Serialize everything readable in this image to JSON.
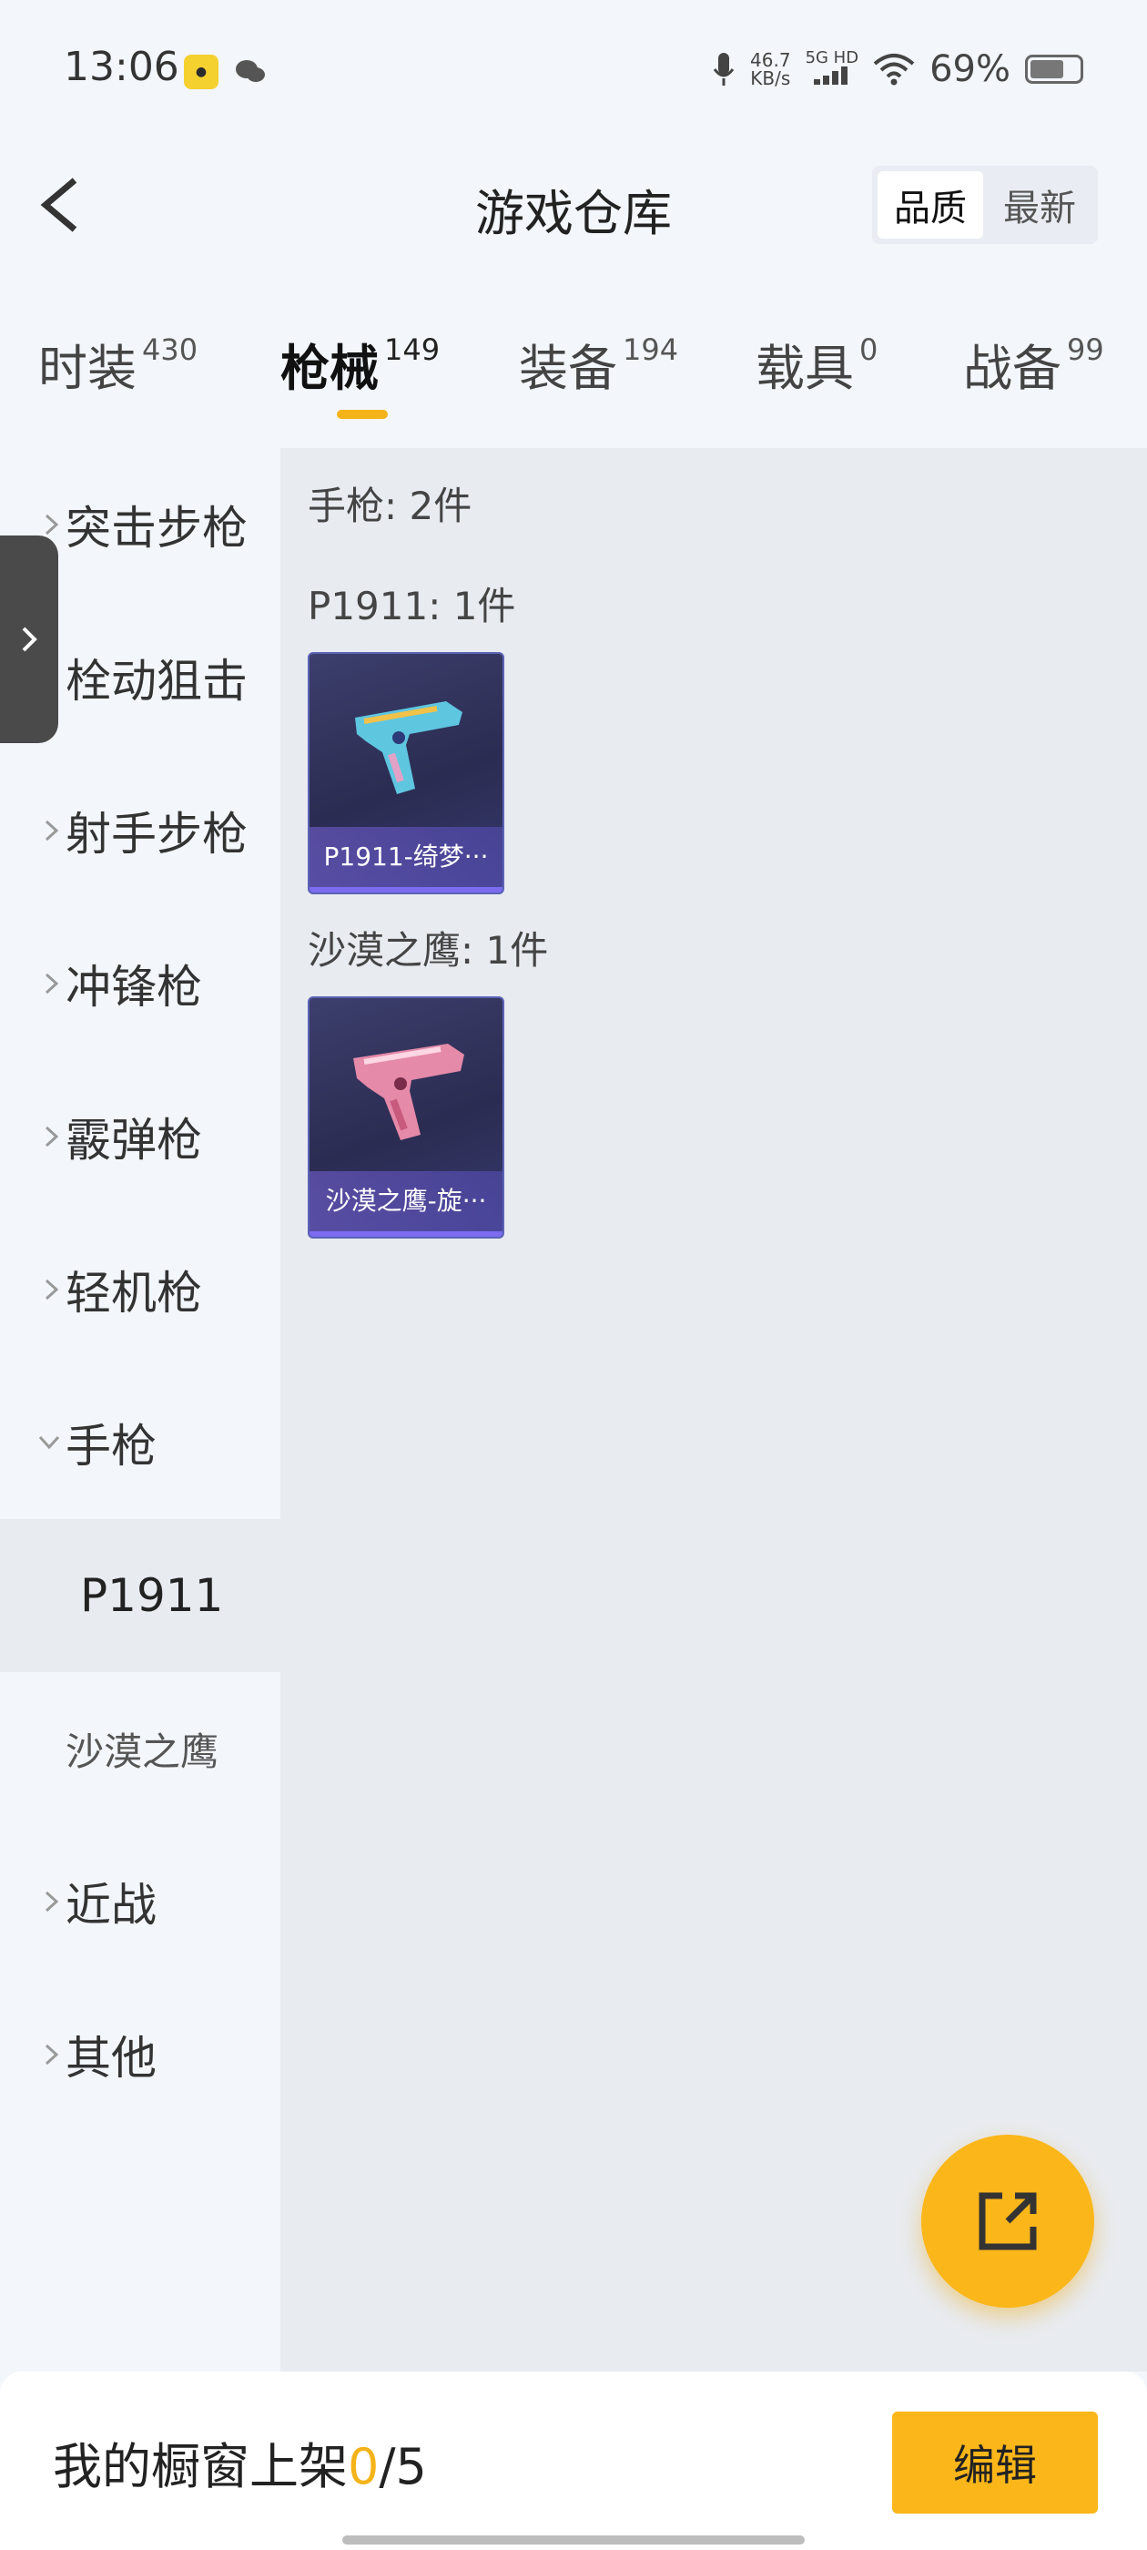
{
  "status_bar": {
    "time": "13:06",
    "net_speed_value": "46.7",
    "net_speed_unit": "KB/s",
    "network": "5G HD",
    "battery": "69%"
  },
  "header": {
    "title": "游戏仓库",
    "sort_options": [
      "品质",
      "最新"
    ],
    "sort_active": "品质"
  },
  "tabs": [
    {
      "label": "时装",
      "count": "430"
    },
    {
      "label": "枪械",
      "count": "149"
    },
    {
      "label": "装备",
      "count": "194"
    },
    {
      "label": "载具",
      "count": "0"
    },
    {
      "label": "战备",
      "count": "99"
    }
  ],
  "active_tab": "枪械",
  "sidebar": {
    "categories": [
      {
        "label": "突击步枪"
      },
      {
        "label": "栓动狙击"
      },
      {
        "label": "射手步枪"
      },
      {
        "label": "冲锋枪"
      },
      {
        "label": "霰弹枪"
      },
      {
        "label": "轻机枪"
      },
      {
        "label": "手枪"
      },
      {
        "label": "近战"
      },
      {
        "label": "其他"
      }
    ],
    "subcategories": [
      {
        "label": "P1911"
      },
      {
        "label": "沙漠之鹰"
      }
    ]
  },
  "content": {
    "summary": "手枪: 2件",
    "groups": [
      {
        "heading": "P1911: 1件",
        "item_name": "P1911-绮梦···"
      },
      {
        "heading": "沙漠之鹰: 1件",
        "item_name": "沙漠之鹰-旋···"
      }
    ]
  },
  "bottom_bar": {
    "showcase_label": "我的橱窗上架",
    "showcase_count": "0",
    "showcase_total": "/5",
    "edit_label": "编辑"
  },
  "colors": {
    "accent": "#fbb61a",
    "background": "#f3f6fb",
    "content_background": "#e8ebf0"
  }
}
